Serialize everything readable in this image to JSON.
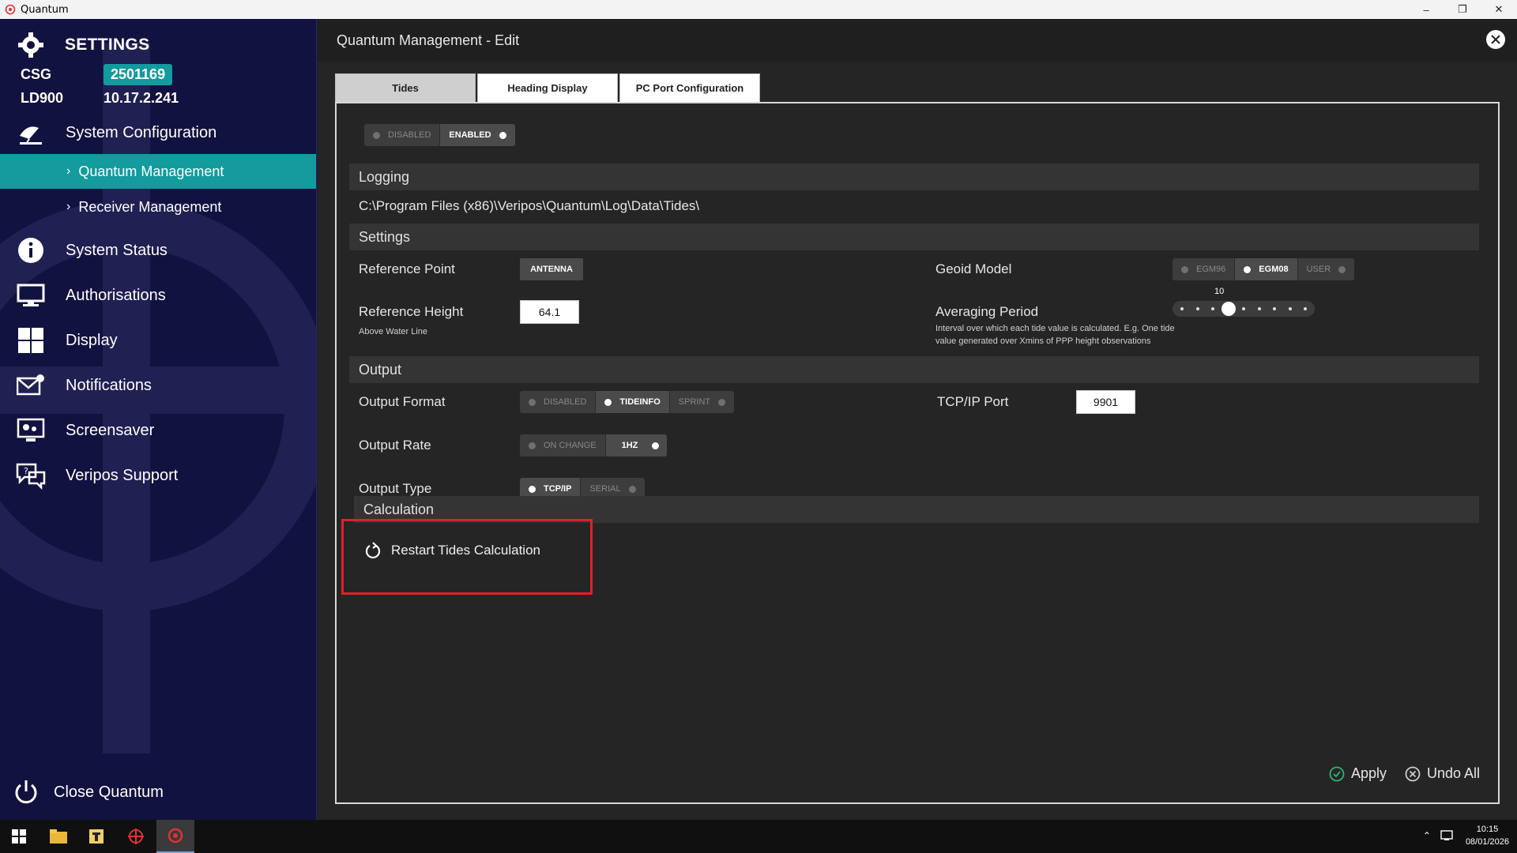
{
  "window": {
    "title": "Quantum"
  },
  "sidebar": {
    "header": "SETTINGS",
    "csg_label": "CSG",
    "csg_value": "2501169",
    "ld_label": "LD900",
    "ld_value": "10.17.2.241",
    "items": [
      {
        "label": "System Configuration",
        "icon": "satellite-dish-icon"
      },
      {
        "label": "System Status",
        "icon": "info-icon"
      },
      {
        "label": "Authorisations",
        "icon": "monitor-icon"
      },
      {
        "label": "Display",
        "icon": "windows-grid-icon"
      },
      {
        "label": "Notifications",
        "icon": "envelope-icon"
      },
      {
        "label": "Screensaver",
        "icon": "screensaver-icon"
      },
      {
        "label": "Veripos Support",
        "icon": "support-chat-icon"
      }
    ],
    "subitems": [
      {
        "label": "Quantum Management",
        "active": true
      },
      {
        "label": "Receiver Management",
        "active": false
      }
    ],
    "close_label": "Close Quantum",
    "accent": "#139b9e"
  },
  "main": {
    "title": "Quantum Management - Edit",
    "tabs": [
      "Tides",
      "Heading Display",
      "PC Port Configuration"
    ],
    "enable_toggle": {
      "options": [
        "DISABLED",
        "ENABLED"
      ],
      "selected": "ENABLED"
    },
    "logging": {
      "section": "Logging",
      "path": "C:\\Program Files (x86)\\Veripos\\Quantum\\Log\\Data\\Tides\\"
    },
    "settings": {
      "section": "Settings",
      "reference_point_label": "Reference Point",
      "reference_point_value": "ANTENNA",
      "reference_height_label": "Reference Height",
      "reference_height_sub": "Above Water Line",
      "reference_height_value": "64.1",
      "geoid_label": "Geoid Model",
      "geoid_options": [
        "EGM96",
        "EGM08",
        "USER"
      ],
      "geoid_selected": "EGM08",
      "averaging_label": "Averaging Period",
      "averaging_value": "10",
      "averaging_fraction": 0.375,
      "averaging_help": "Interval over which each tide value is calculated. E.g. One tide value generated over Xmins of PPP height observations"
    },
    "output": {
      "section": "Output",
      "format_label": "Output Format",
      "format_options": [
        "DISABLED",
        "TIDEINFO",
        "SPRINT"
      ],
      "format_selected": "TIDEINFO",
      "tcp_label": "TCP/IP Port",
      "tcp_value": "9901",
      "rate_label": "Output Rate",
      "rate_options": [
        "ON CHANGE",
        "1HZ"
      ],
      "rate_selected": "1HZ",
      "type_label": "Output Type",
      "type_options": [
        "TCP/IP",
        "SERIAL"
      ],
      "type_selected": "TCP/IP"
    },
    "calculation": {
      "section": "Calculation",
      "restart_label": "Restart Tides Calculation"
    },
    "footer": {
      "apply": "Apply",
      "undo": "Undo All"
    }
  },
  "taskbar": {
    "time": "10:15",
    "date": "08/01/2026"
  }
}
